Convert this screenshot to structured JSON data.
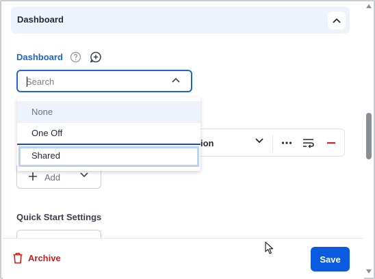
{
  "section": {
    "title": "Dashboard"
  },
  "field": {
    "label": "Dashboard"
  },
  "search": {
    "placeholder": "Search",
    "value": ""
  },
  "dropdown": {
    "options": [
      {
        "label": "None"
      },
      {
        "label": "One Off"
      },
      {
        "label": "Shared"
      }
    ]
  },
  "row": {
    "label": "ion"
  },
  "add": {
    "label": "Add"
  },
  "quick_start": {
    "title": "Quick Start Settings"
  },
  "footer": {
    "archive_label": "Archive",
    "save_label": "Save"
  },
  "colors": {
    "accent": "#0b5be0",
    "danger": "#c81e1e",
    "header_bg": "#eef3fb",
    "label_blue": "#1a64d6"
  }
}
